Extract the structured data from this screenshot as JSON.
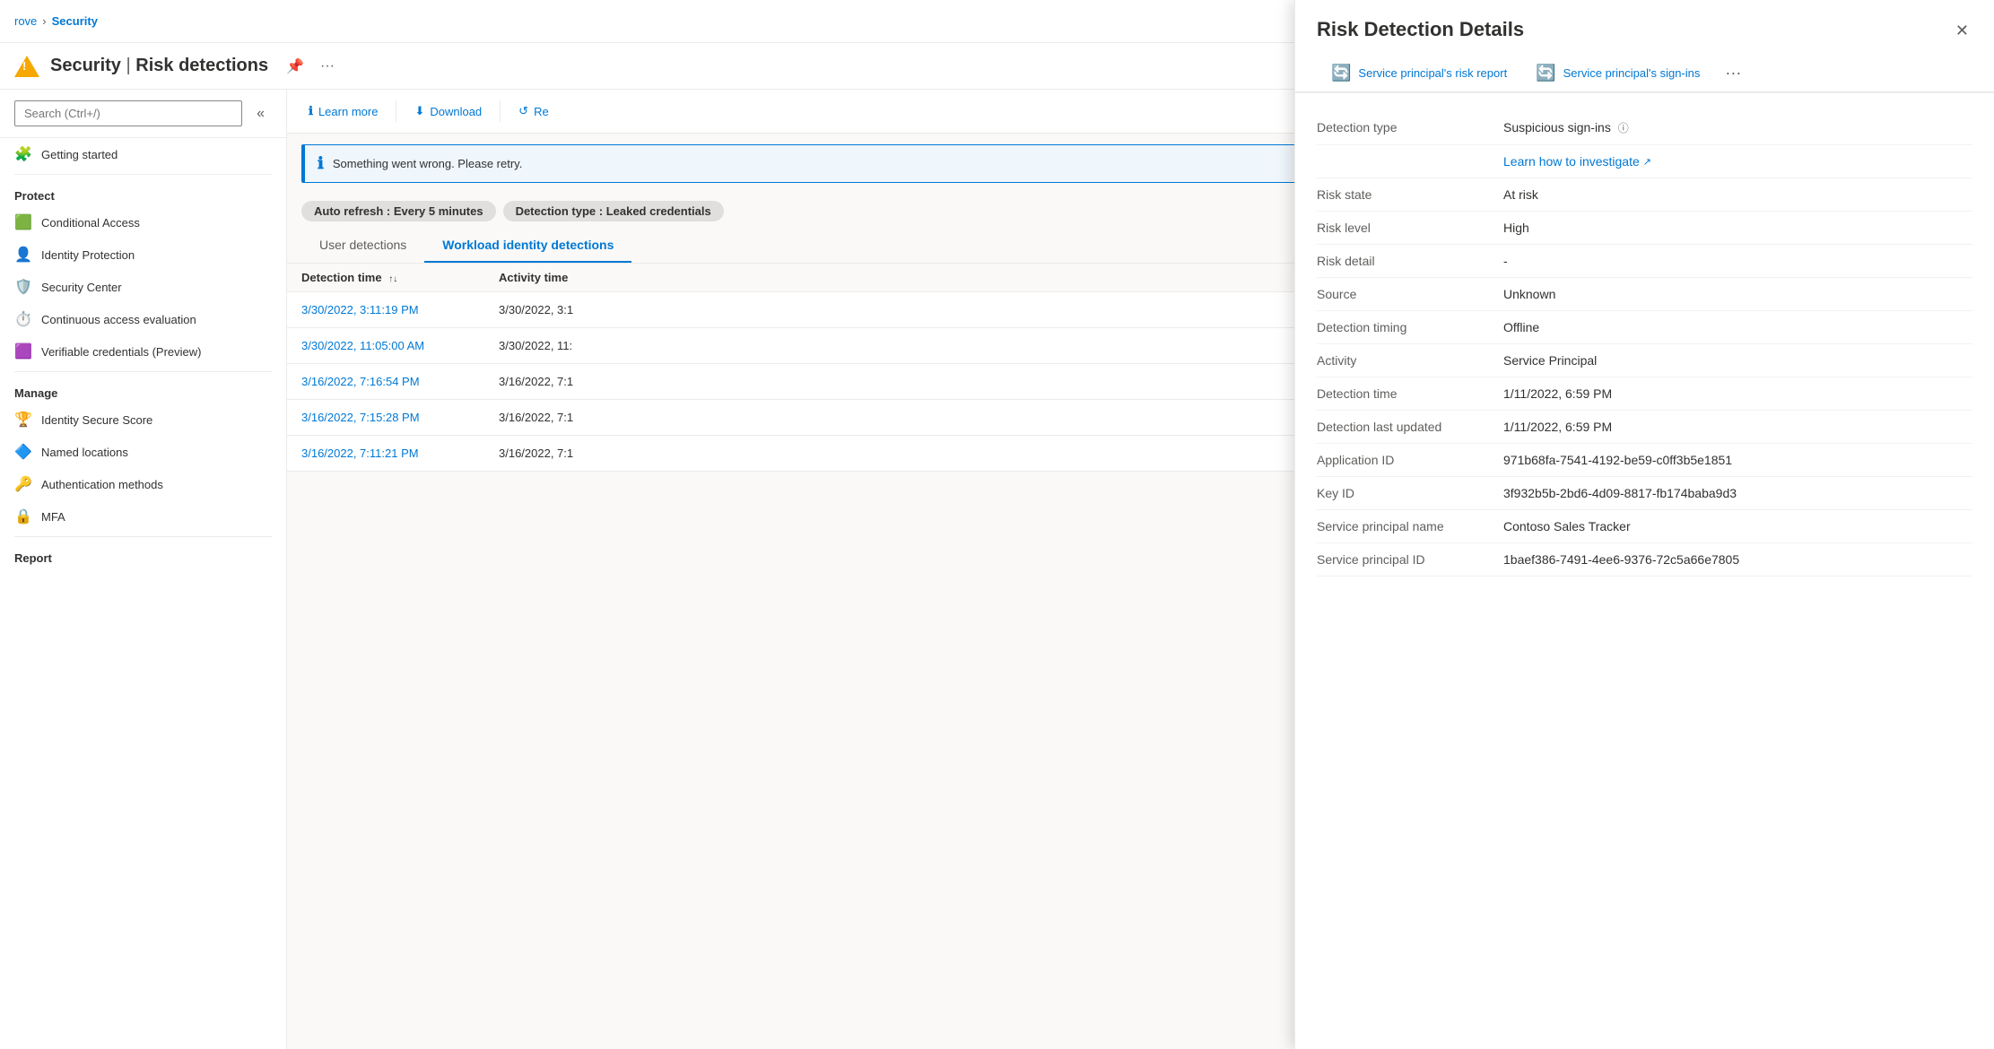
{
  "breadcrumb": {
    "items": [
      {
        "label": "rove",
        "href": "#"
      },
      {
        "label": "Security",
        "href": "#"
      }
    ]
  },
  "header": {
    "title": "Security",
    "subtitle": "Risk detections",
    "pin_label": "Pin",
    "more_label": "More"
  },
  "sidebar": {
    "search_placeholder": "Search (Ctrl+/)",
    "sections": [
      {
        "items": [
          {
            "id": "getting-started",
            "label": "Getting started",
            "icon": "🧩"
          }
        ]
      },
      {
        "section_label": "Protect",
        "items": [
          {
            "id": "conditional-access",
            "label": "Conditional Access",
            "icon": "🟩"
          },
          {
            "id": "identity-protection",
            "label": "Identity Protection",
            "icon": "👤"
          },
          {
            "id": "security-center",
            "label": "Security Center",
            "icon": "🛡️"
          },
          {
            "id": "continuous-access",
            "label": "Continuous access evaluation",
            "icon": "⏱️"
          },
          {
            "id": "verifiable-credentials",
            "label": "Verifiable credentials (Preview)",
            "icon": "🟪"
          }
        ]
      },
      {
        "section_label": "Manage",
        "items": [
          {
            "id": "identity-secure-score",
            "label": "Identity Secure Score",
            "icon": "🏆"
          },
          {
            "id": "named-locations",
            "label": "Named locations",
            "icon": "🔷"
          },
          {
            "id": "authentication-methods",
            "label": "Authentication methods",
            "icon": "🔑"
          },
          {
            "id": "mfa",
            "label": "MFA",
            "icon": "🔒"
          }
        ]
      },
      {
        "section_label": "Report",
        "items": []
      }
    ]
  },
  "toolbar": {
    "learn_more": "Learn more",
    "download": "Download",
    "refresh": "Re"
  },
  "alert": {
    "message": "Something went wrong. Please retry."
  },
  "filters": [
    {
      "label": "Auto refresh : ",
      "value": "Every 5 minutes"
    },
    {
      "label": "Detection type : ",
      "value": "Leaked credentials"
    }
  ],
  "tabs": [
    {
      "id": "user-detections",
      "label": "User detections",
      "active": false
    },
    {
      "id": "workload-identity",
      "label": "Workload identity detections",
      "active": true
    }
  ],
  "table": {
    "columns": [
      {
        "label": "Detection time",
        "sort": true
      },
      {
        "label": "Activity time",
        "sort": false
      }
    ],
    "rows": [
      {
        "detection_time": "3/30/2022, 3:11:19 PM",
        "activity_time": "3/30/2022, 3:1"
      },
      {
        "detection_time": "3/30/2022, 11:05:00 AM",
        "activity_time": "3/30/2022, 11:"
      },
      {
        "detection_time": "3/16/2022, 7:16:54 PM",
        "activity_time": "3/16/2022, 7:1"
      },
      {
        "detection_time": "3/16/2022, 7:15:28 PM",
        "activity_time": "3/16/2022, 7:1"
      },
      {
        "detection_time": "3/16/2022, 7:11:21 PM",
        "activity_time": "3/16/2022, 7:1"
      }
    ]
  },
  "panel": {
    "title": "Risk Detection Details",
    "close_label": "Close",
    "tabs": [
      {
        "id": "risk-report",
        "label": "Service principal's risk report",
        "icon": "🔄"
      },
      {
        "id": "sign-ins",
        "label": "Service principal's sign-ins",
        "icon": "🔄"
      }
    ],
    "details": [
      {
        "label": "Detection type",
        "value": "Suspicious sign-ins",
        "info": true,
        "link": null
      },
      {
        "label": "",
        "value": "Learn how to investigate",
        "link": true
      },
      {
        "label": "Risk state",
        "value": "At risk"
      },
      {
        "label": "Risk level",
        "value": "High"
      },
      {
        "label": "Risk detail",
        "value": "-"
      },
      {
        "label": "Source",
        "value": "Unknown"
      },
      {
        "label": "Detection timing",
        "value": "Offline"
      },
      {
        "label": "Activity",
        "value": "Service Principal"
      },
      {
        "label": "Detection time",
        "value": "1/11/2022, 6:59 PM"
      },
      {
        "label": "Detection last updated",
        "value": "1/11/2022, 6:59 PM"
      },
      {
        "label": "Application ID",
        "value": "971b68fa-7541-4192-be59-c0ff3b5e1851"
      },
      {
        "label": "Key ID",
        "value": "3f932b5b-2bd6-4d09-8817-fb174baba9d3"
      },
      {
        "label": "Service principal name",
        "value": "Contoso Sales Tracker"
      },
      {
        "label": "Service principal ID",
        "value": "1baef386-7491-4ee6-9376-72c5a66e7805"
      }
    ]
  }
}
